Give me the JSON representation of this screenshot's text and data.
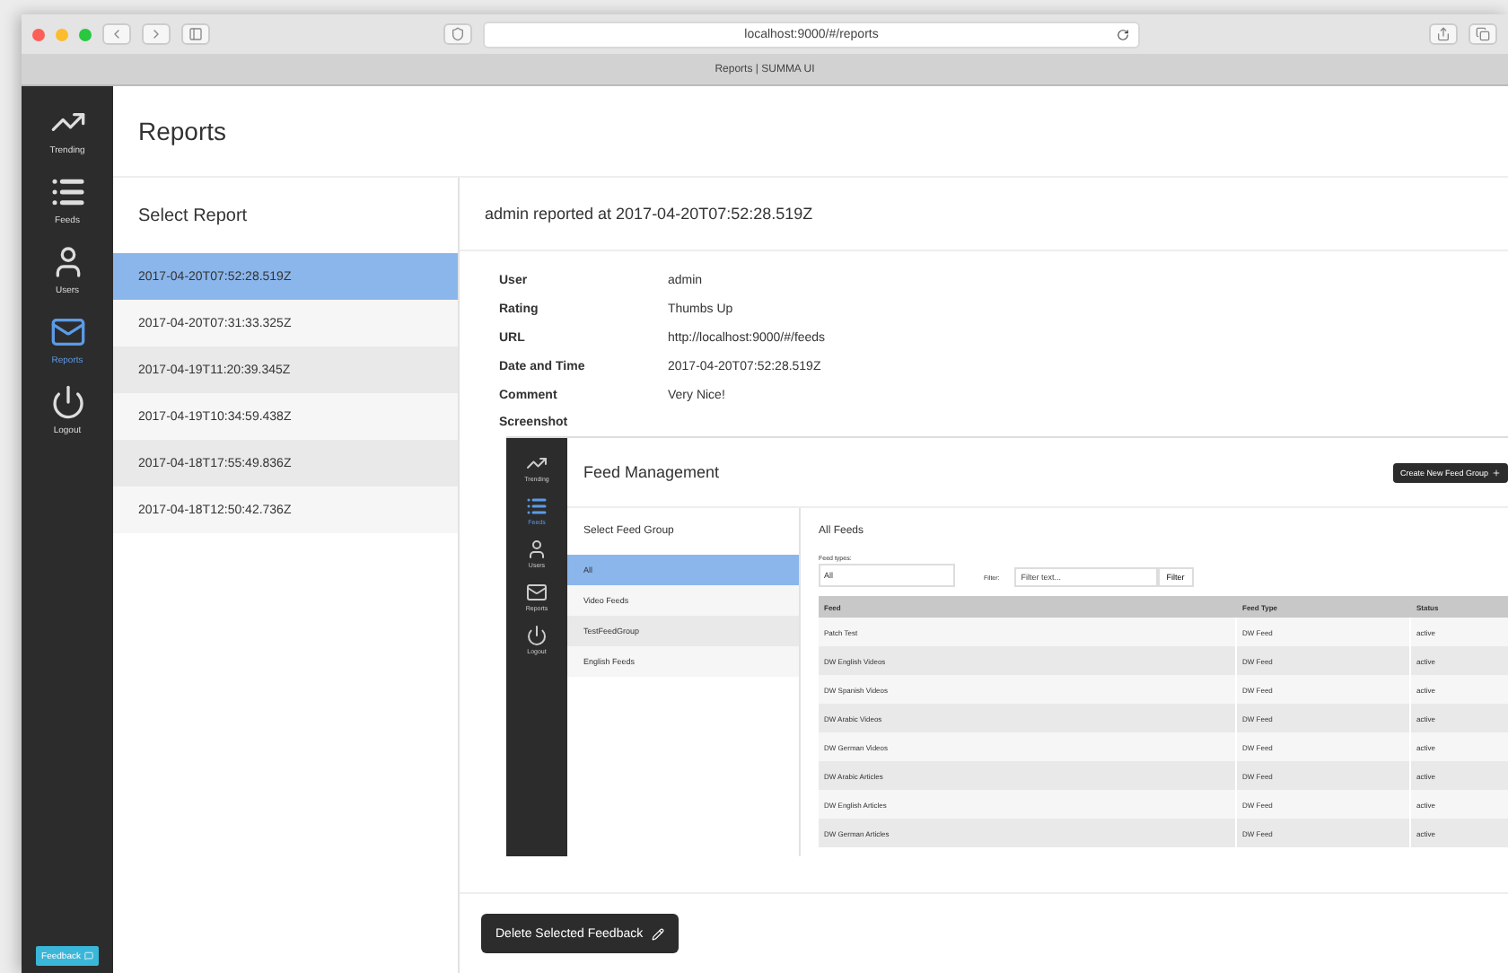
{
  "browser": {
    "url": "localhost:9000/#/reports",
    "tab_title": "Reports | SUMMA UI"
  },
  "sidebar": {
    "items": [
      {
        "label": "Trending",
        "selected": false
      },
      {
        "label": "Feeds",
        "selected": false
      },
      {
        "label": "Users",
        "selected": false
      },
      {
        "label": "Reports",
        "selected": true
      },
      {
        "label": "Logout",
        "selected": false
      }
    ],
    "feedback_button": "Feedback"
  },
  "header": {
    "title": "Reports"
  },
  "report_list": {
    "title": "Select Report",
    "items": [
      {
        "label": "2017-04-20T07:52:28.519Z",
        "selected": true
      },
      {
        "label": "2017-04-20T07:31:33.325Z",
        "selected": false
      },
      {
        "label": "2017-04-19T11:20:39.345Z",
        "selected": false
      },
      {
        "label": "2017-04-19T10:34:59.438Z",
        "selected": false
      },
      {
        "label": "2017-04-18T17:55:49.836Z",
        "selected": false
      },
      {
        "label": "2017-04-18T12:50:42.736Z",
        "selected": false
      }
    ]
  },
  "detail": {
    "title": "admin reported at 2017-04-20T07:52:28.519Z",
    "fields": [
      {
        "label": "User",
        "value": "admin"
      },
      {
        "label": "Rating",
        "value": "Thumbs Up"
      },
      {
        "label": "URL",
        "value": "http://localhost:9000/#/feeds"
      },
      {
        "label": "Date and Time",
        "value": "2017-04-20T07:52:28.519Z"
      },
      {
        "label": "Comment",
        "value": "Very Nice!"
      }
    ],
    "screenshot_label": "Screenshot",
    "screenshot": {
      "sidebar": [
        {
          "label": "Trending",
          "selected": false
        },
        {
          "label": "Feeds",
          "selected": true
        },
        {
          "label": "Users",
          "selected": false
        },
        {
          "label": "Reports",
          "selected": false
        },
        {
          "label": "Logout",
          "selected": false
        }
      ],
      "title": "Feed Management",
      "create_button": "Create New Feed Group",
      "group_list": {
        "title": "Select Feed Group",
        "items": [
          {
            "label": "All",
            "selected": true
          },
          {
            "label": "Video Feeds",
            "selected": false
          },
          {
            "label": "TestFeedGroup",
            "selected": false
          },
          {
            "label": "English Feeds",
            "selected": false
          }
        ]
      },
      "feeds": {
        "title": "All Feeds",
        "feed_types_label": "Feed types:",
        "feed_types_value": "All",
        "filter_label": "Filter:",
        "filter_placeholder": "Filter text...",
        "filter_button": "Filter",
        "columns": [
          "Feed",
          "Feed Type",
          "Status"
        ],
        "rows": [
          [
            "Patch Test",
            "DW Feed",
            "active"
          ],
          [
            "DW English Videos",
            "DW Feed",
            "active"
          ],
          [
            "DW Spanish Videos",
            "DW Feed",
            "active"
          ],
          [
            "DW Arabic Videos",
            "DW Feed",
            "active"
          ],
          [
            "DW German Videos",
            "DW Feed",
            "active"
          ],
          [
            "DW Arabic Articles",
            "DW Feed",
            "active"
          ],
          [
            "DW English Articles",
            "DW Feed",
            "active"
          ],
          [
            "DW German Articles",
            "DW Feed",
            "active"
          ]
        ]
      }
    }
  },
  "footer": {
    "delete_button": "Delete Selected Feedback"
  }
}
